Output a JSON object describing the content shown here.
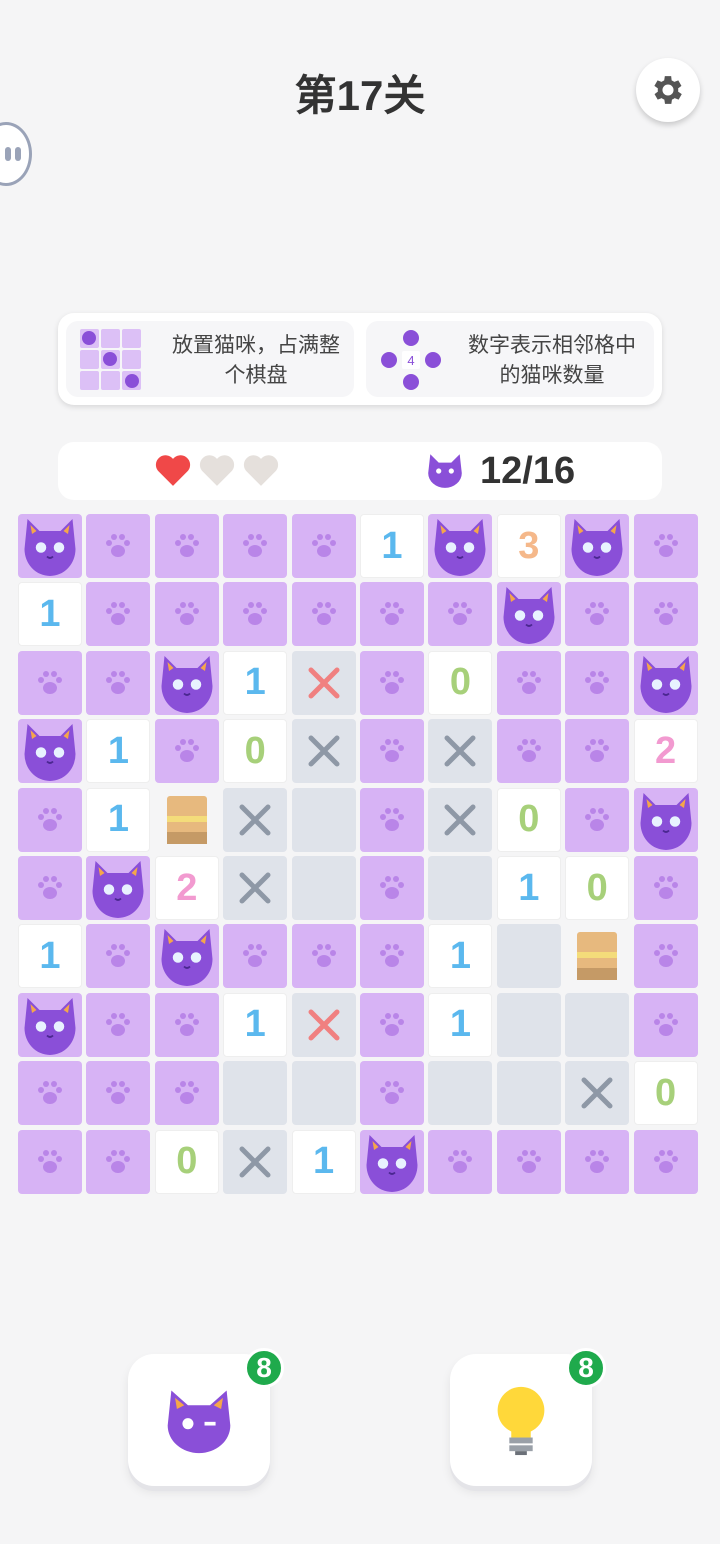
{
  "header": {
    "title": "第17关"
  },
  "rules": {
    "rule1": "放置猫咪，占满整个棋盘",
    "rule2": "数字表示相邻格中的猫咪数量",
    "illu_number": "4"
  },
  "status": {
    "lives_total": 3,
    "lives_remaining": 1,
    "cats_count": "12/16"
  },
  "colors": {
    "paw_cell": "#d7b3f5",
    "revealed_cell": "#ffffff",
    "blocked_cell": "#dfe3ea",
    "number_1": "#5bb8ee",
    "number_0": "#a7d07a",
    "number_2": "#f29ad0",
    "number_3": "#f5b88a",
    "x_gray": "#8e98a6",
    "x_red": "#f08080",
    "heart_full": "#f04848",
    "heart_empty": "#e5e0dc",
    "badge": "#1faa4c"
  },
  "board": {
    "rows": [
      [
        "cat",
        "paw",
        "paw",
        "paw",
        "paw",
        "1",
        "cat",
        "3",
        "cat",
        "paw"
      ],
      [
        "1",
        "paw",
        "paw",
        "paw",
        "paw",
        "paw",
        "paw",
        "cat",
        "paw",
        "paw"
      ],
      [
        "paw",
        "paw",
        "cat",
        "1",
        "xr",
        "paw",
        "0",
        "paw",
        "paw",
        "cat"
      ],
      [
        "cat",
        "1",
        "paw",
        "0",
        "x",
        "paw",
        "x",
        "paw",
        "paw",
        "2"
      ],
      [
        "paw",
        "1",
        "box",
        "x",
        "empty",
        "paw",
        "x",
        "0",
        "paw",
        "cat"
      ],
      [
        "paw",
        "cat",
        "2",
        "x",
        "empty",
        "paw",
        "empty",
        "1",
        "0",
        "paw"
      ],
      [
        "1",
        "paw",
        "cat",
        "paw",
        "paw",
        "paw",
        "1",
        "empty",
        "box",
        "paw"
      ],
      [
        "cat",
        "paw",
        "paw",
        "1",
        "xr",
        "paw",
        "1",
        "empty",
        "empty",
        "paw"
      ],
      [
        "paw",
        "paw",
        "paw",
        "empty",
        "empty",
        "paw",
        "empty",
        "empty",
        "x",
        "0"
      ],
      [
        "paw",
        "paw",
        "0",
        "x",
        "1",
        "cat",
        "paw",
        "paw",
        "paw",
        "paw"
      ]
    ]
  },
  "tools": {
    "cat_tool": {
      "icon": "cat-icon",
      "count": "8"
    },
    "hint_tool": {
      "icon": "lightbulb-icon",
      "count": "8"
    }
  }
}
